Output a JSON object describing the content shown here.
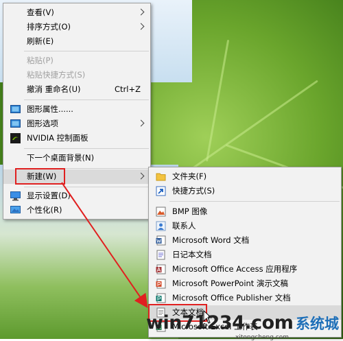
{
  "context_menu": {
    "items": [
      {
        "label": "查看(V)",
        "shortcut": "",
        "submenu": true,
        "disabled": false,
        "icon": ""
      },
      {
        "label": "排序方式(O)",
        "shortcut": "",
        "submenu": true,
        "disabled": false,
        "icon": ""
      },
      {
        "label": "刷新(E)",
        "shortcut": "",
        "submenu": false,
        "disabled": false,
        "icon": ""
      },
      {
        "label": "粘贴(P)",
        "shortcut": "",
        "submenu": false,
        "disabled": true,
        "icon": ""
      },
      {
        "label": "粘贴快捷方式(S)",
        "shortcut": "",
        "submenu": false,
        "disabled": true,
        "icon": ""
      },
      {
        "label": "撤消 重命名(U)",
        "shortcut": "Ctrl+Z",
        "submenu": false,
        "disabled": false,
        "icon": ""
      },
      {
        "label": "图形属性......",
        "shortcut": "",
        "submenu": false,
        "disabled": false,
        "icon": "intel-graphics-icon"
      },
      {
        "label": "图形选项",
        "shortcut": "",
        "submenu": true,
        "disabled": false,
        "icon": "intel-graphics-icon"
      },
      {
        "label": "NVIDIA 控制面板",
        "shortcut": "",
        "submenu": false,
        "disabled": false,
        "icon": "nvidia-icon"
      },
      {
        "label": "下一个桌面背景(N)",
        "shortcut": "",
        "submenu": false,
        "disabled": false,
        "icon": ""
      },
      {
        "label": "新建(W)",
        "shortcut": "",
        "submenu": true,
        "disabled": false,
        "icon": ""
      },
      {
        "label": "显示设置(D)",
        "shortcut": "",
        "submenu": false,
        "disabled": false,
        "icon": "display-icon"
      },
      {
        "label": "个性化(R)",
        "shortcut": "",
        "submenu": false,
        "disabled": false,
        "icon": "personalize-icon"
      }
    ]
  },
  "new_submenu": {
    "items": [
      {
        "label": "文件夹(F)",
        "icon": "folder-icon"
      },
      {
        "label": "快捷方式(S)",
        "icon": "shortcut-icon"
      },
      {
        "label": "BMP 图像",
        "icon": "bmp-icon"
      },
      {
        "label": "联系人",
        "icon": "contact-icon"
      },
      {
        "label": "Microsoft Word 文档",
        "icon": "word-icon"
      },
      {
        "label": "日记本文档",
        "icon": "journal-icon"
      },
      {
        "label": "Microsoft Office Access 应用程序",
        "icon": "access-icon"
      },
      {
        "label": "Microsoft PowerPoint 演示文稿",
        "icon": "powerpoint-icon"
      },
      {
        "label": "Microsoft Office Publisher 文档",
        "icon": "publisher-icon"
      },
      {
        "label": "文本文档",
        "icon": "text-document-icon"
      },
      {
        "label": "Microsoft Excel 工作表",
        "icon": "excel-icon"
      }
    ]
  },
  "watermark": {
    "main": "win71234.com",
    "chinese": "系统城",
    "sub": "xitongcheng.com"
  },
  "colors": {
    "menu_bg": "#f2f2f2",
    "highlight": "#dadada",
    "annotation_red": "#e02020"
  }
}
